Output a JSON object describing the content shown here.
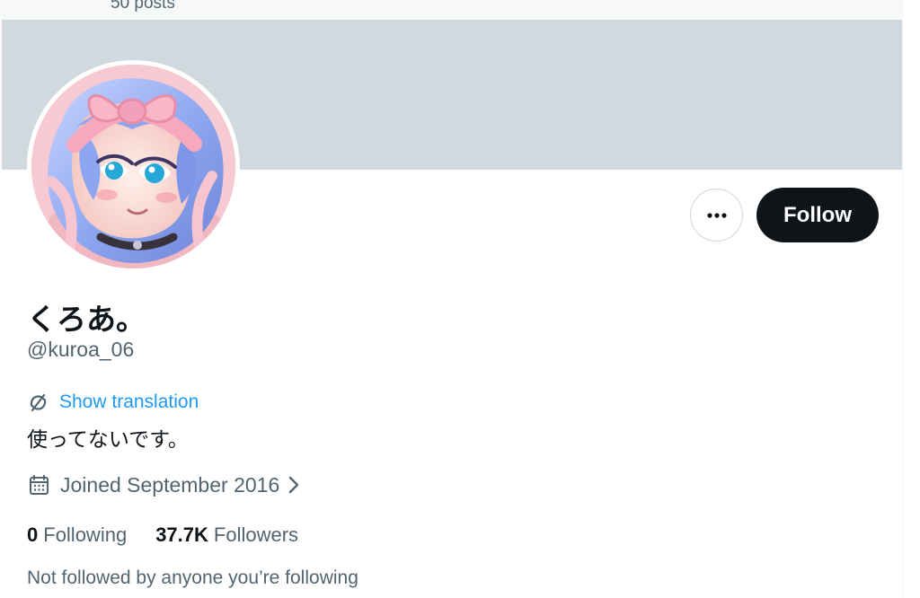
{
  "header": {
    "post_count": "50 posts"
  },
  "profile": {
    "display_name": "くろあ。",
    "handle": "@kuroa_06",
    "show_translation_label": "Show translation",
    "bio": "使ってないです。",
    "joined": "Joined September 2016",
    "following_count": "0",
    "following_label": "Following",
    "followers_count": "37.7K",
    "followers_label": "Followers",
    "followed_by_note": "Not followed by anyone you’re following"
  },
  "actions": {
    "follow_label": "Follow",
    "more_icon": "more-horizontal-icon"
  },
  "icons": {
    "translation": "translate-icon",
    "calendar": "calendar-icon",
    "joined_chevron": "chevron-right-icon"
  },
  "colors": {
    "banner": "#cfd9de",
    "follow_button": "#0f1419",
    "link": "#1d9bf0",
    "secondary_text": "#536471",
    "primary_text": "#0f1419"
  }
}
